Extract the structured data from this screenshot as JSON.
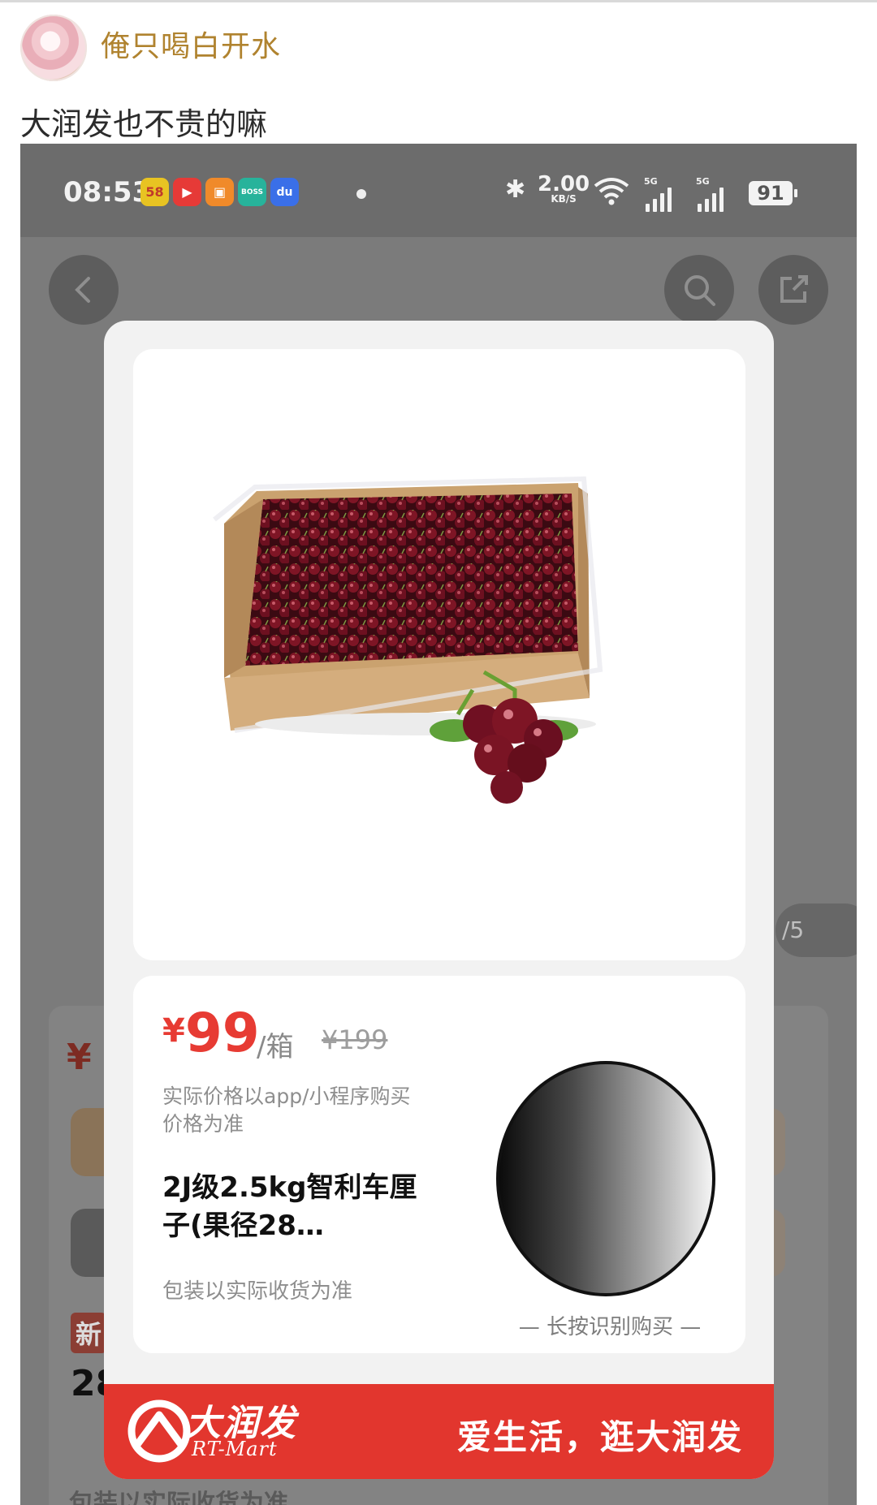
{
  "post": {
    "author": "俺只喝白开水",
    "text": "大润发也不贵的嘛"
  },
  "status_bar": {
    "time": "08:53",
    "app_icons": [
      {
        "name": "58-app-icon",
        "label": "58",
        "color": "#e8c322"
      },
      {
        "name": "video-app-icon",
        "label": "▶",
        "color": "#e63a37"
      },
      {
        "name": "gift-app-icon",
        "label": "▣",
        "color": "#f08a2a"
      },
      {
        "name": "boss-app-icon",
        "label": "BOSS",
        "color": "#27b39b"
      },
      {
        "name": "baidu-app-icon",
        "label": "du",
        "color": "#3a6fe8"
      }
    ],
    "speed_value": "2.00",
    "speed_unit": "KB/S",
    "signal_1": "5G",
    "signal_2": "5G",
    "battery": "91"
  },
  "background_page": {
    "page_indicator": "/5",
    "price_fragment": "¥",
    "badge_fragment": "新",
    "number_fragment": "28",
    "bottom_fragment": "包装以实际收货为准"
  },
  "product": {
    "price_symbol": "¥",
    "price": "99",
    "unit": "/箱",
    "original_price": "¥199",
    "price_note": "实际价格以app/小程序购买价格为准",
    "title": "2J级2.5kg智利车厘子(果径28…",
    "packaging_note": "包装以实际收货为准",
    "qr_caption": "— 长按识别购买 —"
  },
  "footer": {
    "brand_cn": "大润发",
    "brand_en": "RT-Mart",
    "slogan": "爱生活，逛大润发",
    "color": "#e2362e"
  }
}
